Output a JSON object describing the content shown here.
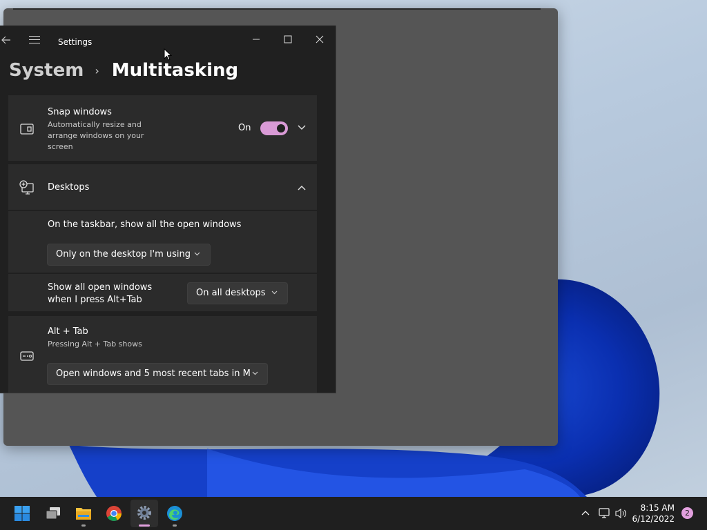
{
  "window": {
    "title": "Settings",
    "breadcrumb_parent": "System",
    "breadcrumb_current": "Multitasking"
  },
  "snap": {
    "label": "Snap windows",
    "description": "Automatically resize and arrange windows on your screen",
    "toggle_text": "On",
    "toggle_on": true
  },
  "desktops": {
    "label": "Desktops",
    "taskbar_label": "On the taskbar, show all the open windows",
    "taskbar_value": "Only on the desktop I'm using",
    "alttab_label": "Show all open windows when I press Alt+Tab",
    "alttab_value": "On all desktops"
  },
  "alt_tab": {
    "label": "Alt + Tab",
    "description": "Pressing Alt + Tab shows",
    "value": "Open windows and 5 most recent tabs in M"
  },
  "taskbar": {
    "apps": [
      "start",
      "task-view",
      "file-explorer",
      "chrome",
      "settings",
      "edge"
    ],
    "active_app": "settings",
    "time": "8:15 AM",
    "date": "6/12/2022",
    "notification_count": "2"
  },
  "colors": {
    "accent": "#d99ad6",
    "background": "#202020",
    "card": "#2b2b2b"
  }
}
